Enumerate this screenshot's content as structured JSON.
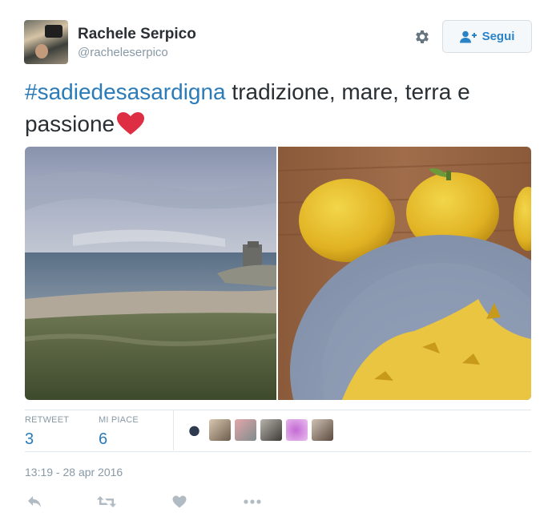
{
  "user": {
    "name": "Rachele Serpico",
    "handle": "@racheleserpico"
  },
  "header": {
    "settings_icon": "gear-icon",
    "follow_label": "Segui",
    "follow_icon": "add-user-icon"
  },
  "tweet": {
    "hashtag": "#sadiedesasardigna",
    "text": " tradizione, mare, terra e passione",
    "emoji": "red-heart"
  },
  "media": {
    "photos": [
      "seaside-tower-photo",
      "citrus-and-bowl-photo"
    ]
  },
  "stats": {
    "retweet_label": "RETWEET",
    "retweet_count": "3",
    "like_label": "MI PIACE",
    "like_count": "6",
    "liker_count": 6
  },
  "timestamp": "13:19 - 28 apr 2016",
  "actions": [
    "reply-icon",
    "retweet-icon",
    "like-icon",
    "more-icon"
  ],
  "colors": {
    "link": "#2b7bb9",
    "follow_text": "#2a83c7",
    "muted": "#8899a6",
    "heart": "#e0245e"
  }
}
